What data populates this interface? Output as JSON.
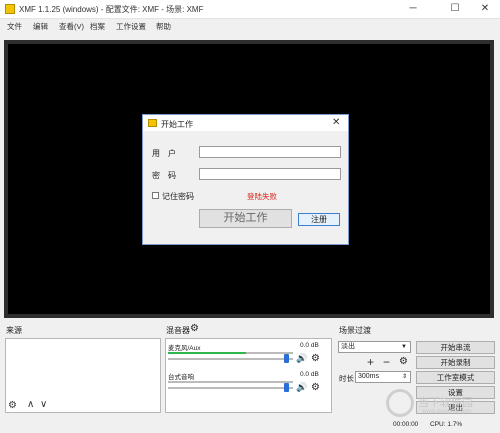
{
  "window": {
    "title": "XMF 1.1.25 (windows) - 配置文件: XMF - 场景: XMF",
    "minimize_glyph": "─",
    "maximize_glyph": "☐",
    "close_glyph": "✕"
  },
  "menu": [
    "文件",
    "编辑",
    "查看(V)",
    "档案",
    "工作设置",
    "帮助"
  ],
  "dialog": {
    "title": "开始工作",
    "user_label": "用　户",
    "password_label": "密　码",
    "remember_label": "记住密码",
    "error_text": "登陆失败",
    "start_button": "开始工作",
    "register_button": "注册",
    "close_glyph": "✕"
  },
  "sources": {
    "title": "来源",
    "add_glyph": "⚙",
    "up_glyph": "∧",
    "down_glyph": "∨"
  },
  "mixer": {
    "title": "混音器",
    "channels": [
      {
        "name": "麦克风/Aux",
        "db": "0.0 dB",
        "level": 0.62,
        "volume": 0.97
      },
      {
        "name": "台式音响",
        "db": "0.0 dB",
        "level": 0.0,
        "volume": 0.97
      }
    ]
  },
  "transitions": {
    "title": "场景过渡",
    "selected": "淡出",
    "duration_label": "时长",
    "duration_value": "300ms",
    "add_glyph": "+",
    "remove_glyph": "−"
  },
  "controls": {
    "start_stream": "开始串流",
    "start_record": "开始录制",
    "studio_mode": "工作室模式",
    "settings": "设置",
    "exit": "退出"
  },
  "status": {
    "time": "00:00:00",
    "cpu": "CPU: 1.7%"
  },
  "watermark": {
    "text": "当下软件园",
    "url": "www.downxia.com"
  },
  "colors": {
    "accent": "#2a6ed8",
    "error": "#d8261c",
    "meter": "#2eb84b",
    "preview_bg": "#000000"
  }
}
